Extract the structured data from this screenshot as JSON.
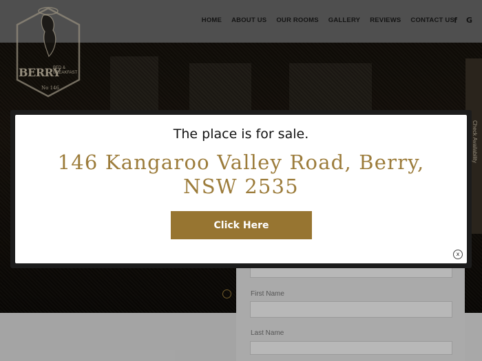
{
  "brand": {
    "name": "BERRY",
    "sub": "BED & BREAKFAST",
    "number": "No 146"
  },
  "nav": {
    "items": [
      "HOME",
      "ABOUT US",
      "OUR ROOMS",
      "GALLERY",
      "REVIEWS",
      "CONTACT US"
    ],
    "social": [
      "f",
      "G"
    ]
  },
  "side_tab": {
    "label": "Check Availability"
  },
  "form": {
    "first_name_label": "First Name",
    "last_name_label": "Last Name"
  },
  "modal": {
    "title": "The place is for sale.",
    "address": "146 Kangaroo Valley Road, Berry, NSW 2535",
    "cta_label": "Click Here",
    "close_label": "x"
  },
  "colors": {
    "accent": "#977531",
    "address_gold": "#9c7c3b",
    "header": "#6e6e6e"
  }
}
